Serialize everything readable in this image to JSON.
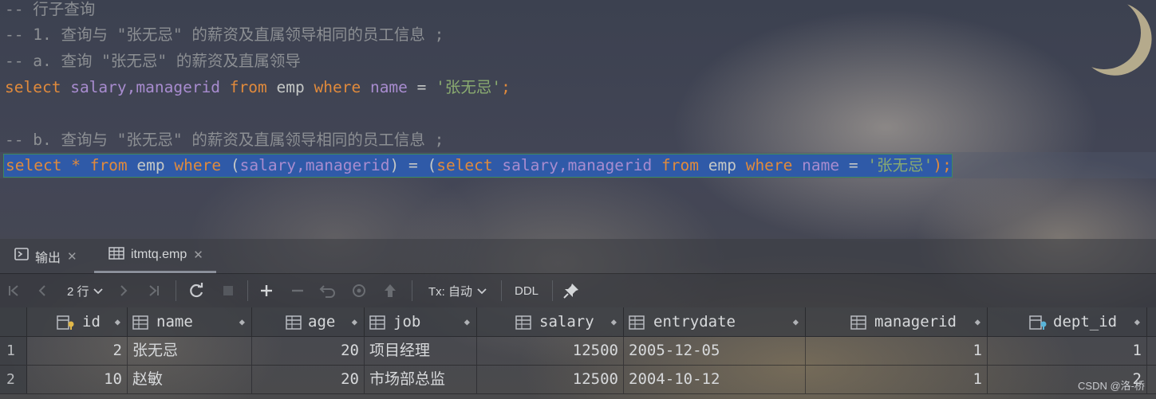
{
  "editor": {
    "lines": {
      "l1": {
        "comment": "-- 行子查询"
      },
      "l2": {
        "comment": "-- 1. 查询与 \"张无忌\" 的薪资及直属领导相同的员工信息 ;"
      },
      "l3": {
        "comment": "-- a. 查询 \"张无忌\" 的薪资及直属领导"
      },
      "l4": {
        "select": "select",
        "fields": "salary,managerid",
        "from": "from",
        "table": "emp",
        "where": "where",
        "col": "name",
        "eq": "=",
        "value": "'张无忌'",
        "end": ";"
      },
      "l5": {
        "comment": "-- b. 查询与 \"张无忌\" 的薪资及直属领导相同的员工信息 ;"
      },
      "l6": {
        "select": "select",
        "star": "*",
        "from": "from",
        "table": "emp",
        "where": "where",
        "open": "(",
        "fields": "salary,managerid",
        "close": ")",
        "eq": "=",
        "open2": "(",
        "select2": "select",
        "fields2": "salary,managerid",
        "from2": "from",
        "table2": "emp",
        "where2": "where",
        "col": "name",
        "eq2": "=",
        "value": "'张无忌'",
        "end": ");"
      }
    }
  },
  "tabs": [
    {
      "label": "输出",
      "icon": "output-icon"
    },
    {
      "label": "itmtq.emp",
      "icon": "table-icon"
    }
  ],
  "toolbar": {
    "rows_label": "2 行",
    "tx_label": "Tx: 自动",
    "ddl_label": "DDL"
  },
  "grid": {
    "columns": [
      "id",
      "name",
      "age",
      "job",
      "salary",
      "entrydate",
      "managerid",
      "dept_id"
    ],
    "rows": [
      {
        "num": "1",
        "id": "2",
        "name": "张无忌",
        "age": "20",
        "job": "项目经理",
        "salary": "12500",
        "entrydate": "2005-12-05",
        "managerid": "1",
        "dept_id": "1"
      },
      {
        "num": "2",
        "id": "10",
        "name": "赵敏",
        "age": "20",
        "job": "市场部总监",
        "salary": "12500",
        "entrydate": "2004-10-12",
        "managerid": "1",
        "dept_id": "2"
      }
    ]
  },
  "watermark": "CSDN @洛-桥",
  "colors": {
    "keyword": "#e08a3c",
    "field": "#a88ccf",
    "string": "#8aab70",
    "comment": "#8c8f93",
    "selection": "#2f5aa8"
  }
}
